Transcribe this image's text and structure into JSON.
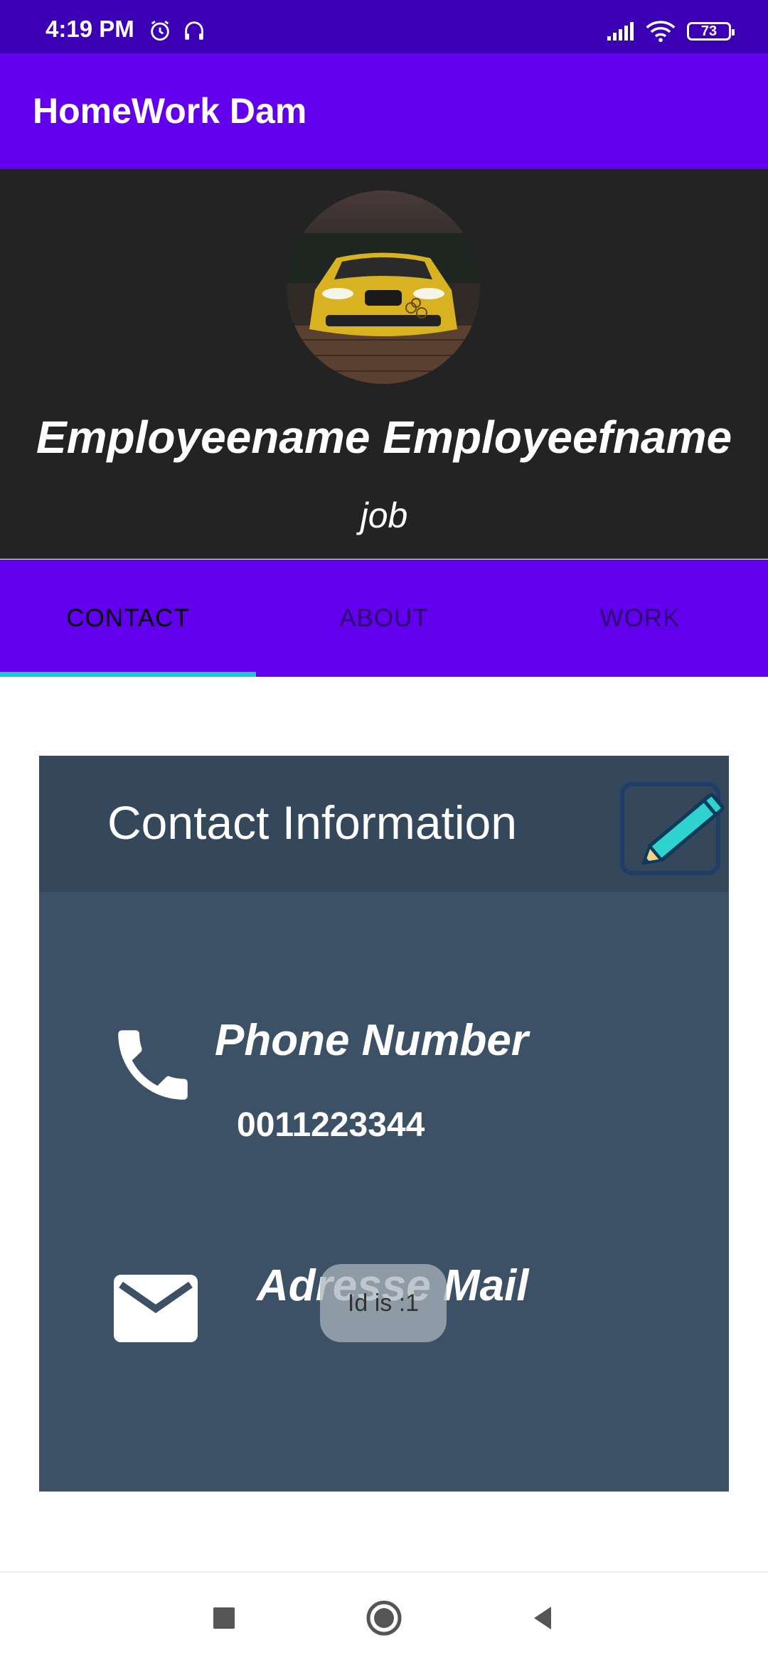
{
  "status_bar": {
    "time": "4:19 PM",
    "battery": "73",
    "icons": [
      "alarm-icon",
      "headset-icon",
      "signal-icon",
      "wifi-icon",
      "battery-icon"
    ]
  },
  "app_bar": {
    "title": "HomeWork Dam"
  },
  "profile": {
    "name": "Employeename Employeefname",
    "job": "job",
    "avatar": "car-photo"
  },
  "tabs": [
    {
      "label": "CONTACT",
      "active": true
    },
    {
      "label": "ABOUT",
      "active": false
    },
    {
      "label": "WORK",
      "active": false
    }
  ],
  "contact_card": {
    "title": "Contact Information",
    "phone_label": "Phone Number",
    "phone_value": "0011223344",
    "mail_label": "Adresse Mail"
  },
  "toast": {
    "text": "Id is :1"
  },
  "colors": {
    "status_bar": "#3b00b4",
    "primary": "#6200ee",
    "header_bg": "#232323",
    "tab_indicator": "#18c9d9",
    "card_bg": "#3d5166",
    "card_header_bg": "#34475b"
  },
  "nav_bar": {
    "buttons": [
      "recents-icon",
      "home-icon",
      "back-icon"
    ]
  }
}
